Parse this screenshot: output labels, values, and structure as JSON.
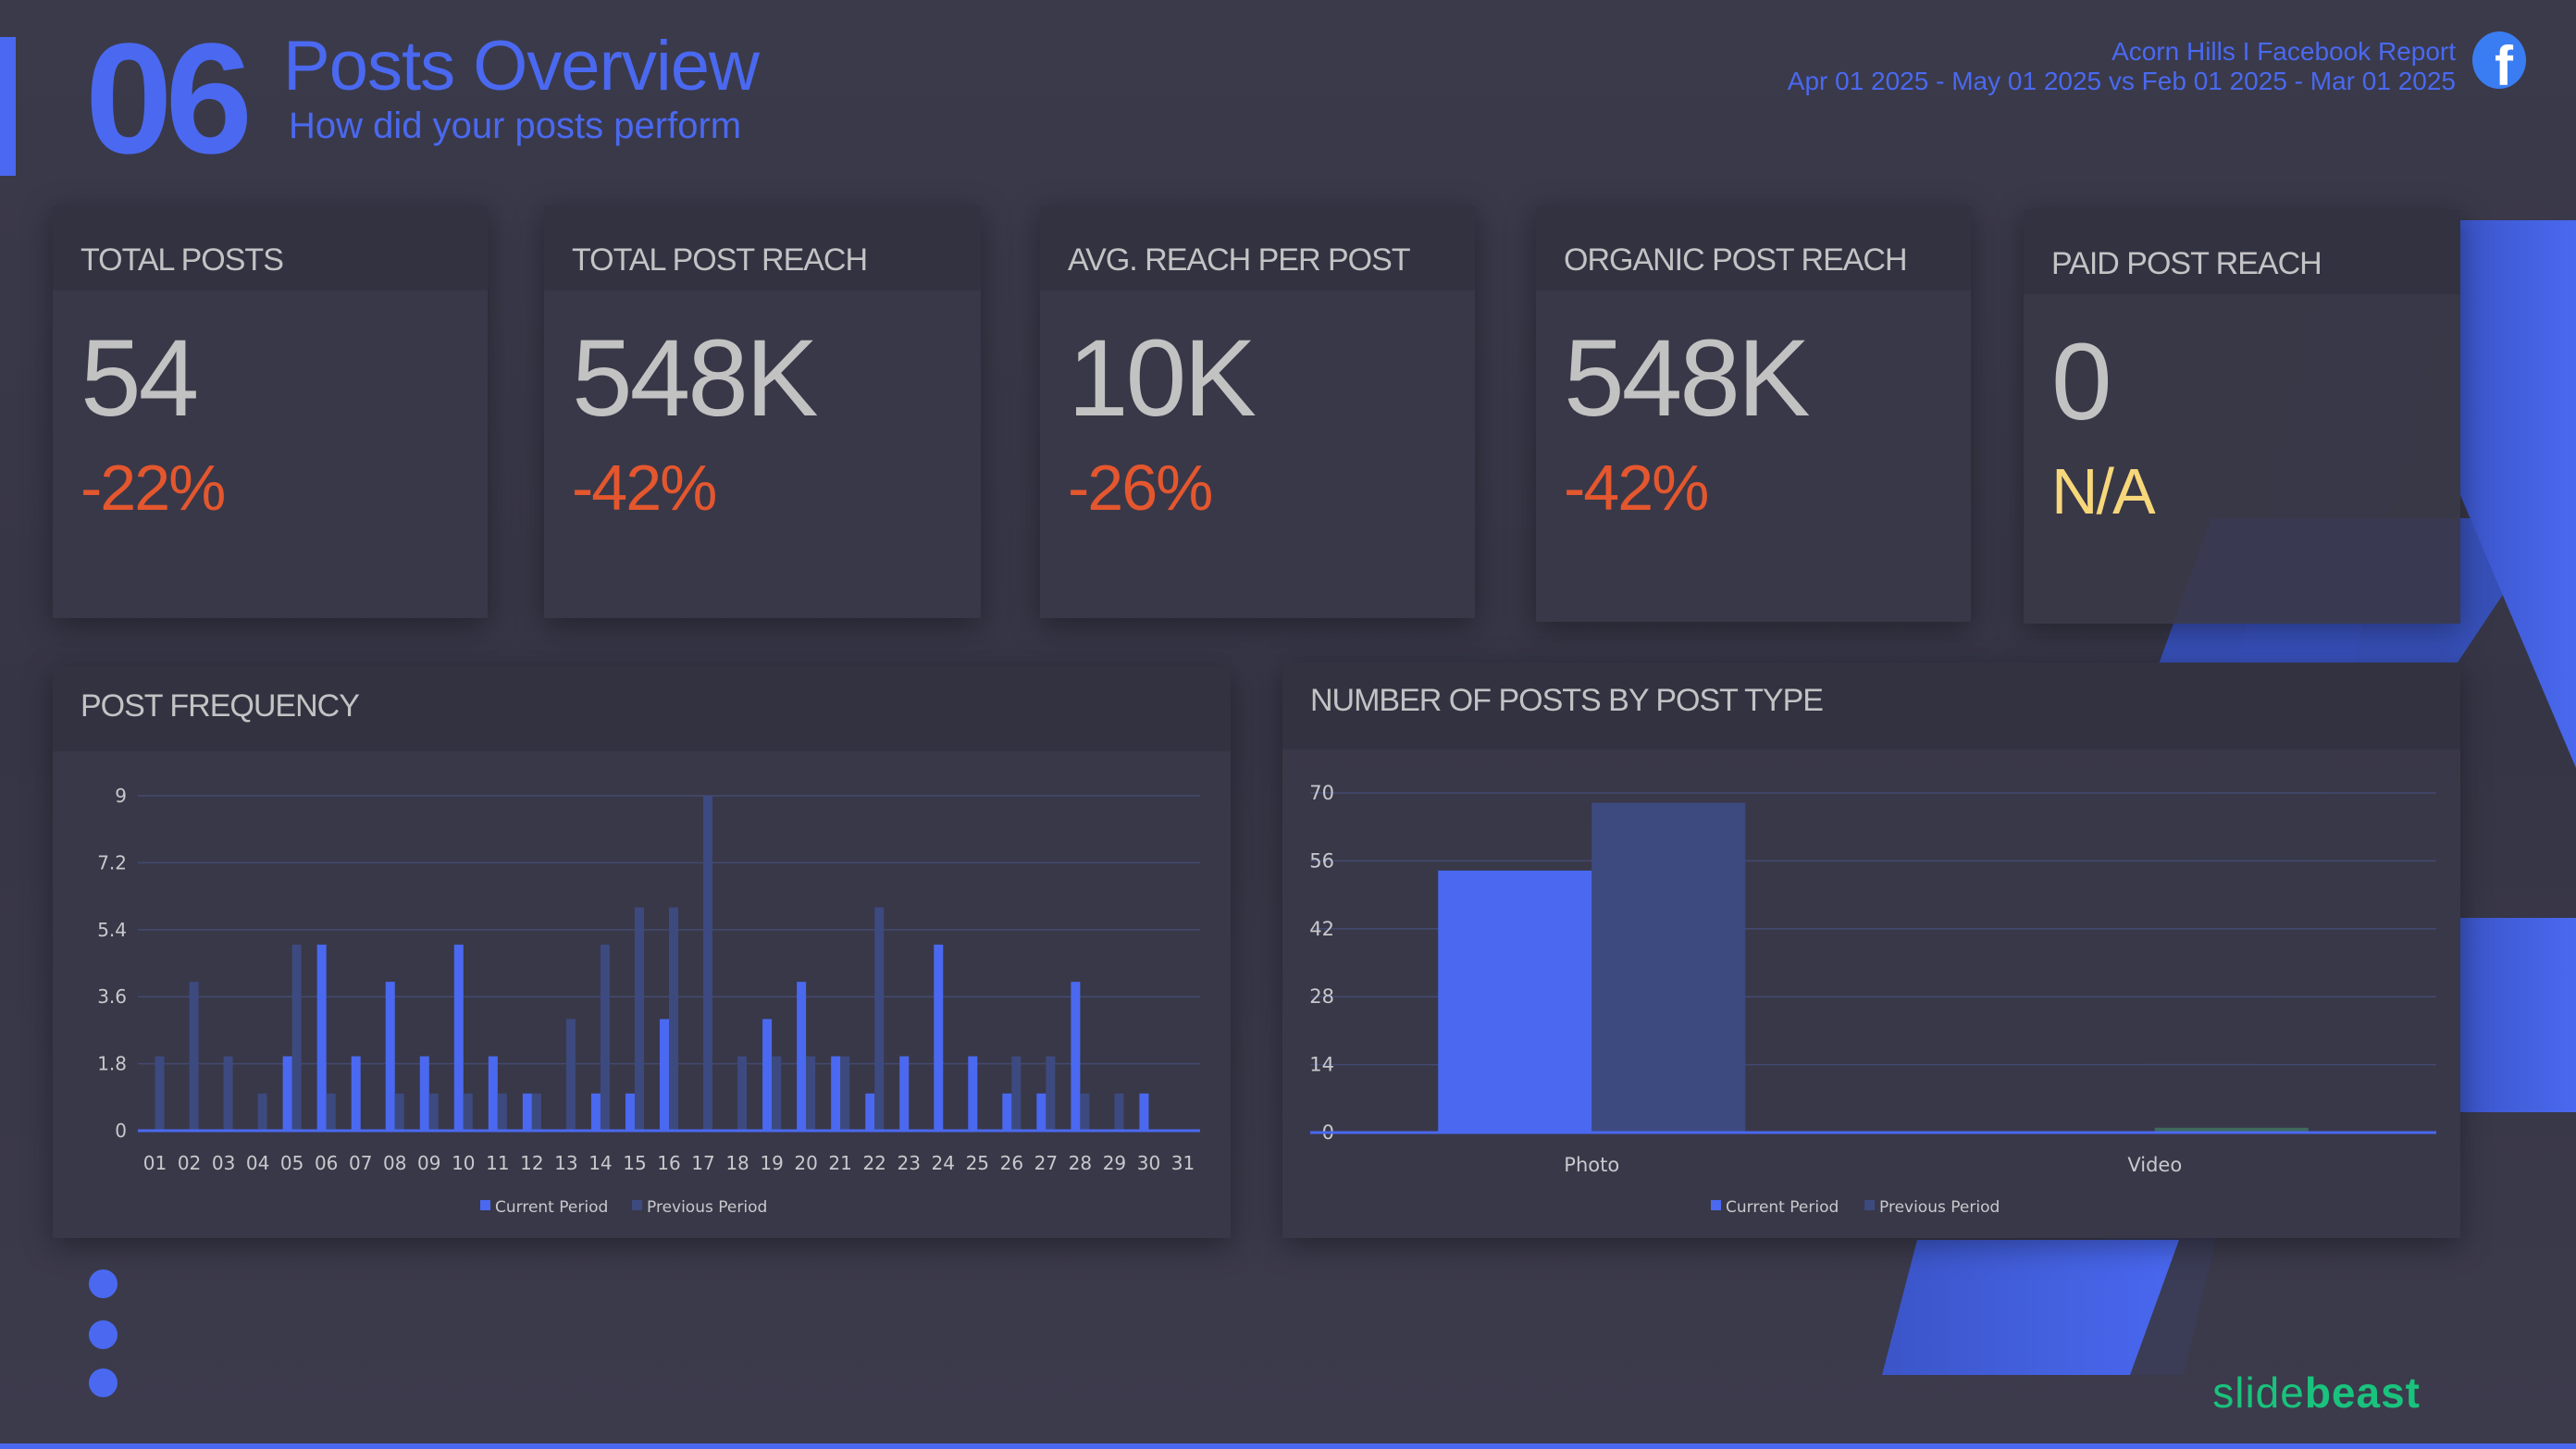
{
  "header": {
    "section_number": "06",
    "title": "Posts Overview",
    "subtitle": "How did your posts perform",
    "report_name": "Acorn Hills  I Facebook Report",
    "date_range": "Apr 01 2025 - May 01 2025 vs Feb 01 2025 - Mar 01 2025",
    "platform_icon": "facebook-icon"
  },
  "colors": {
    "accent": "#4a69f0",
    "negative": "#e4572e",
    "neutral_na": "#f7d77a",
    "previous_series": "#3d4a80",
    "brand_logo": "#19c37d"
  },
  "kpis": [
    {
      "label": "TOTAL POSTS",
      "value": "54",
      "change": "-22%",
      "status": "negative"
    },
    {
      "label": "TOTAL POST REACH",
      "value": "548K",
      "change": "-42%",
      "status": "negative"
    },
    {
      "label": "AVG. REACH PER POST",
      "value": "10K",
      "change": "-26%",
      "status": "negative"
    },
    {
      "label": "ORGANIC POST REACH",
      "value": "548K",
      "change": "-42%",
      "status": "negative"
    },
    {
      "label": "PAID POST REACH",
      "value": "0",
      "change": "N/A",
      "status": "na"
    }
  ],
  "panels": {
    "frequency_title": "POST FREQUENCY",
    "type_title": "NUMBER OF POSTS BY POST TYPE"
  },
  "chart_data": [
    {
      "type": "bar",
      "title": "POST FREQUENCY",
      "xlabel": "",
      "ylabel": "",
      "categories": [
        "01",
        "02",
        "03",
        "04",
        "05",
        "06",
        "07",
        "08",
        "09",
        "10",
        "11",
        "12",
        "13",
        "14",
        "15",
        "16",
        "17",
        "18",
        "19",
        "20",
        "21",
        "22",
        "23",
        "24",
        "25",
        "26",
        "27",
        "28",
        "29",
        "30",
        "31"
      ],
      "series": [
        {
          "name": "Current Period",
          "color": "#4a69f0",
          "values": [
            0,
            0,
            0,
            0,
            2,
            5,
            2,
            4,
            2,
            5,
            2,
            1,
            0,
            1,
            1,
            3,
            0,
            0,
            3,
            4,
            2,
            1,
            2,
            5,
            2,
            1,
            1,
            4,
            0,
            1,
            0
          ]
        },
        {
          "name": "Previous Period",
          "color": "#3d4a80",
          "values": [
            2,
            4,
            2,
            1,
            5,
            1,
            0,
            1,
            1,
            1,
            1,
            1,
            3,
            5,
            6,
            6,
            9,
            2,
            2,
            2,
            2,
            6,
            0,
            0,
            0,
            2,
            2,
            1,
            1,
            0,
            0
          ]
        }
      ],
      "yticks": [
        "0",
        "1.8",
        "3.6",
        "5.4",
        "7.2",
        "9"
      ],
      "ylim": [
        0,
        9
      ],
      "grid": true,
      "legend": "bottom-center"
    },
    {
      "type": "bar",
      "title": "NUMBER OF POSTS BY POST TYPE",
      "xlabel": "",
      "ylabel": "",
      "categories": [
        "Photo",
        "Video"
      ],
      "series": [
        {
          "name": "Current Period",
          "color": "#4a69f0",
          "values": [
            54,
            0
          ]
        },
        {
          "name": "Previous Period",
          "color": "#3d4a80",
          "values": [
            68,
            1
          ]
        }
      ],
      "yticks": [
        "0",
        "14",
        "28",
        "42",
        "56",
        "70"
      ],
      "ylim": [
        0,
        70
      ],
      "grid": true,
      "legend": "bottom-center"
    }
  ],
  "footer": {
    "logo_light": "slide",
    "logo_bold": "beast"
  }
}
